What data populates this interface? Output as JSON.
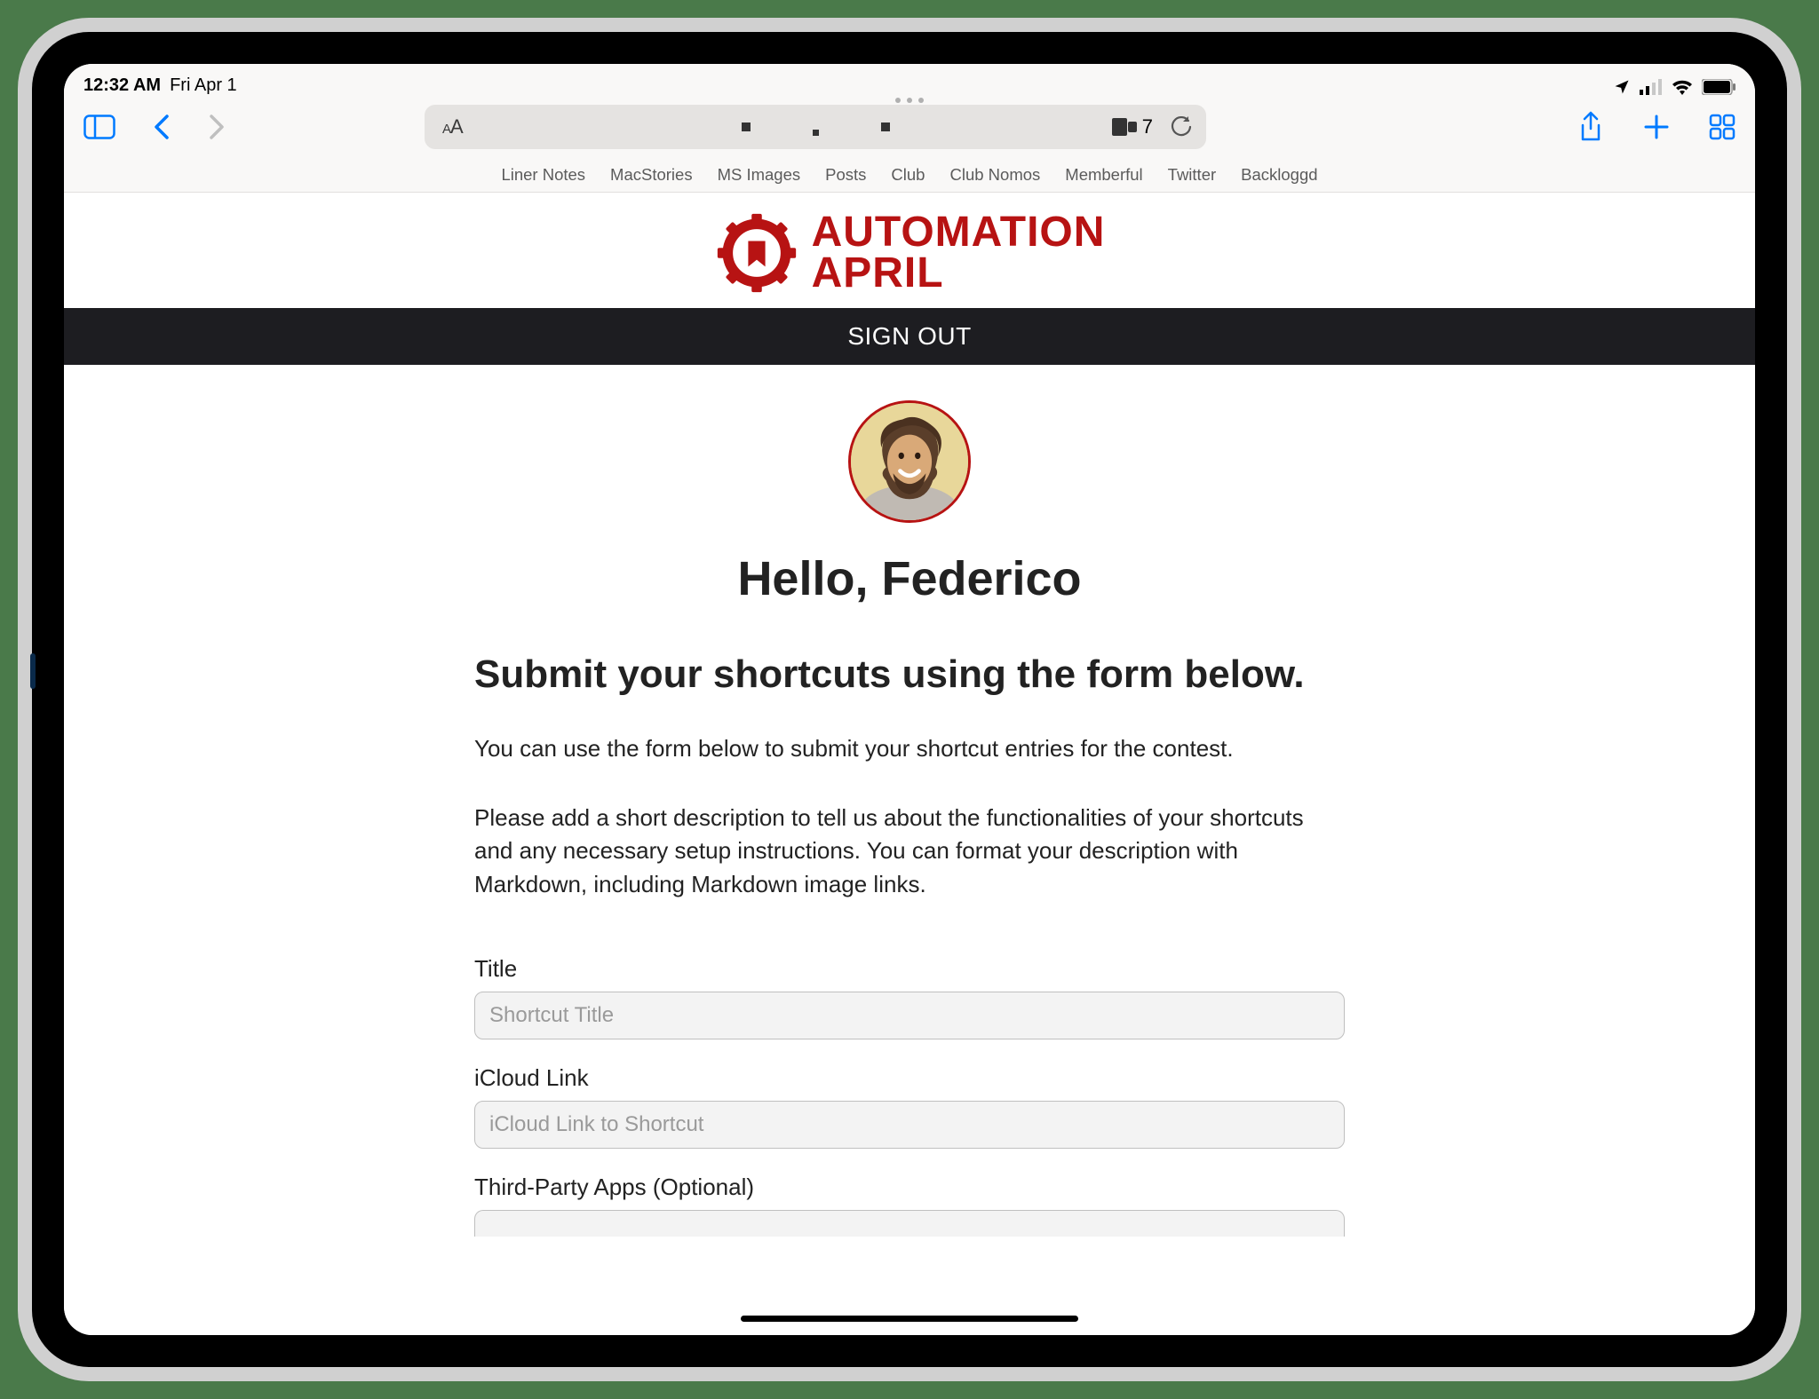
{
  "status": {
    "time": "12:32 AM",
    "date": "Fri Apr 1"
  },
  "browser": {
    "reader_count": "7",
    "favorites": [
      "Liner Notes",
      "MacStories",
      "MS Images",
      "Posts",
      "Club",
      "Club Nomos",
      "Memberful",
      "Twitter",
      "Backloggd"
    ]
  },
  "page": {
    "logo_line1": "AUTOMATION",
    "logo_line2": "APRIL",
    "sign_out": "SIGN OUT",
    "hello": "Hello, Federico",
    "subtitle": "Submit your shortcuts using the form below.",
    "para1": "You can use the form below to submit your shortcut entries for the contest.",
    "para2": "Please add a short description to tell us about the functionalities of your shortcuts and any necessary setup instructions. You can format your description with Markdown, including Markdown image links.",
    "fields": {
      "title_label": "Title",
      "title_placeholder": "Shortcut Title",
      "icloud_label": "iCloud Link",
      "icloud_placeholder": "iCloud Link to Shortcut",
      "third_party_label": "Third-Party Apps (Optional)"
    }
  }
}
